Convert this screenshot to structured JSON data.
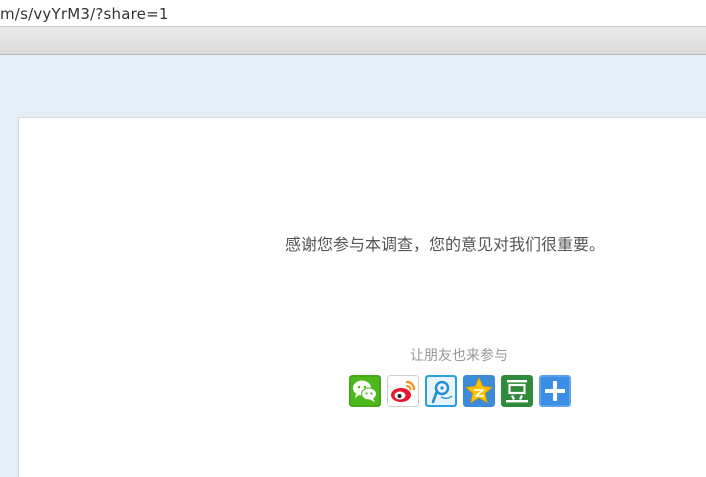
{
  "browser": {
    "address": "m/s/vyYrM3/?share=1"
  },
  "survey": {
    "thanks_message": "感谢您参与本调查，您的意见对我们很重要。",
    "share_prompt": "让朋友也来参与"
  },
  "share_buttons": [
    {
      "icon": "wechat-icon",
      "color": "#4cb81a"
    },
    {
      "icon": "weibo-icon",
      "color": "#e6162d"
    },
    {
      "icon": "tencent-weibo-icon",
      "color": "#1f8fd6"
    },
    {
      "icon": "qzone-icon",
      "color": "#f5b000"
    },
    {
      "icon": "douban-icon",
      "color": "#2f8a3a"
    },
    {
      "icon": "more-share-icon",
      "color": "#3a8ee6"
    }
  ]
}
